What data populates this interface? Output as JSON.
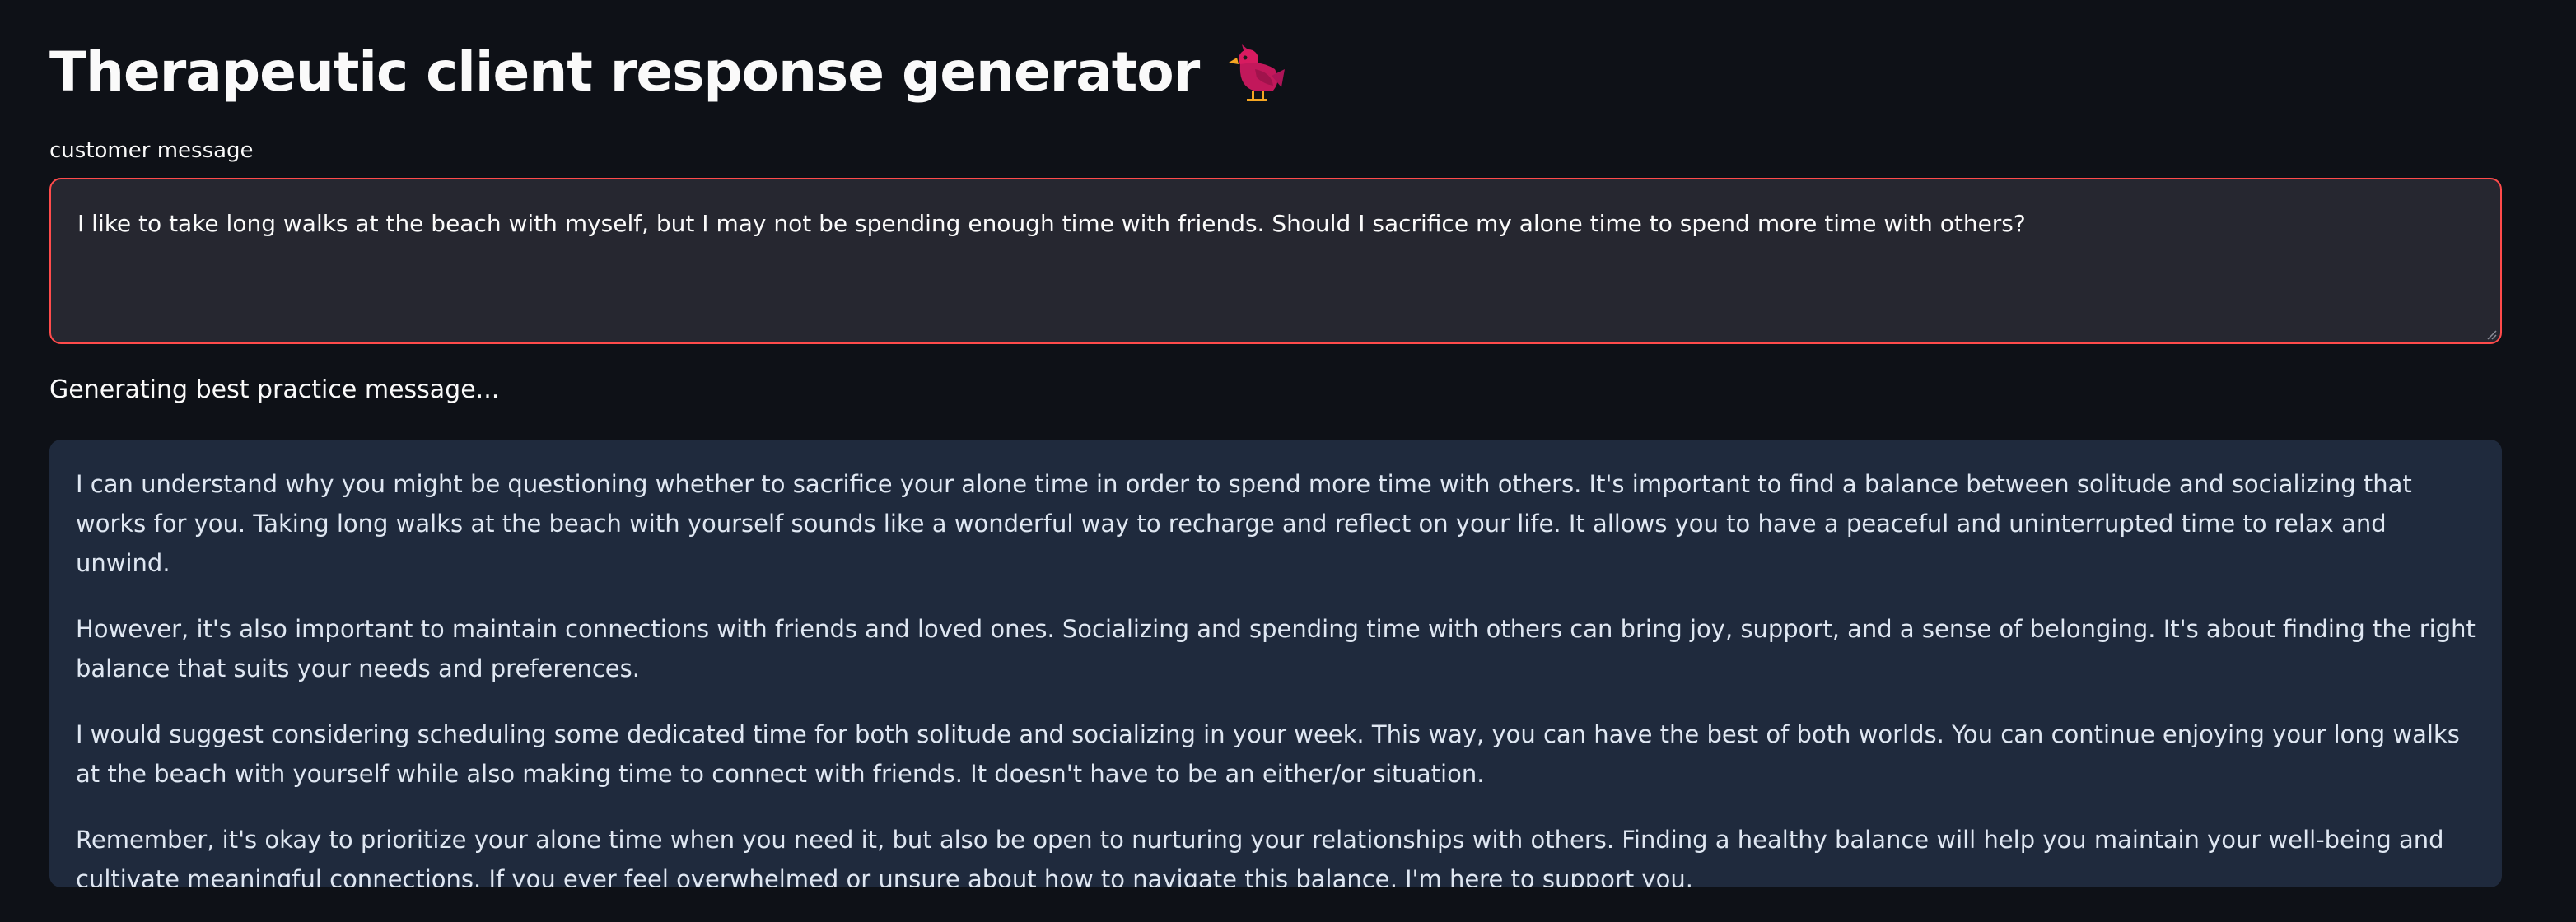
{
  "header": {
    "title": "Therapeutic client response generator",
    "icon": "bird-icon",
    "icon_color": "#c2185b"
  },
  "input": {
    "label": "customer message",
    "value": "I like to take long walks at the beach with myself, but I may not be spending enough time with friends. Should I sacrifice my alone time to spend more time with others?",
    "border_color": "#ff4b4b"
  },
  "status": {
    "text": "Generating best practice message..."
  },
  "response": {
    "paragraphs": [
      "I can understand why you might be questioning whether to sacrifice your alone time in order to spend more time with others. It's important to find a balance between solitude and socializing that works for you. Taking long walks at the beach with yourself sounds like a wonderful way to recharge and reflect on your life. It allows you to have a peaceful and uninterrupted time to relax and unwind.",
      "However, it's also important to maintain connections with friends and loved ones. Socializing and spending time with others can bring joy, support, and a sense of belonging. It's about finding the right balance that suits your needs and preferences.",
      "I would suggest considering scheduling some dedicated time for both solitude and socializing in your week. This way, you can have the best of both worlds. You can continue enjoying your long walks at the beach with yourself while also making time to connect with friends. It doesn't have to be an either/or situation.",
      "Remember, it's okay to prioritize your alone time when you need it, but also be open to nurturing your relationships with others. Finding a healthy balance will help you maintain your well-being and cultivate meaningful connections. If you ever feel overwhelmed or unsure about how to navigate this balance, I'm here to support you."
    ],
    "background_color": "#1f2a3d"
  }
}
